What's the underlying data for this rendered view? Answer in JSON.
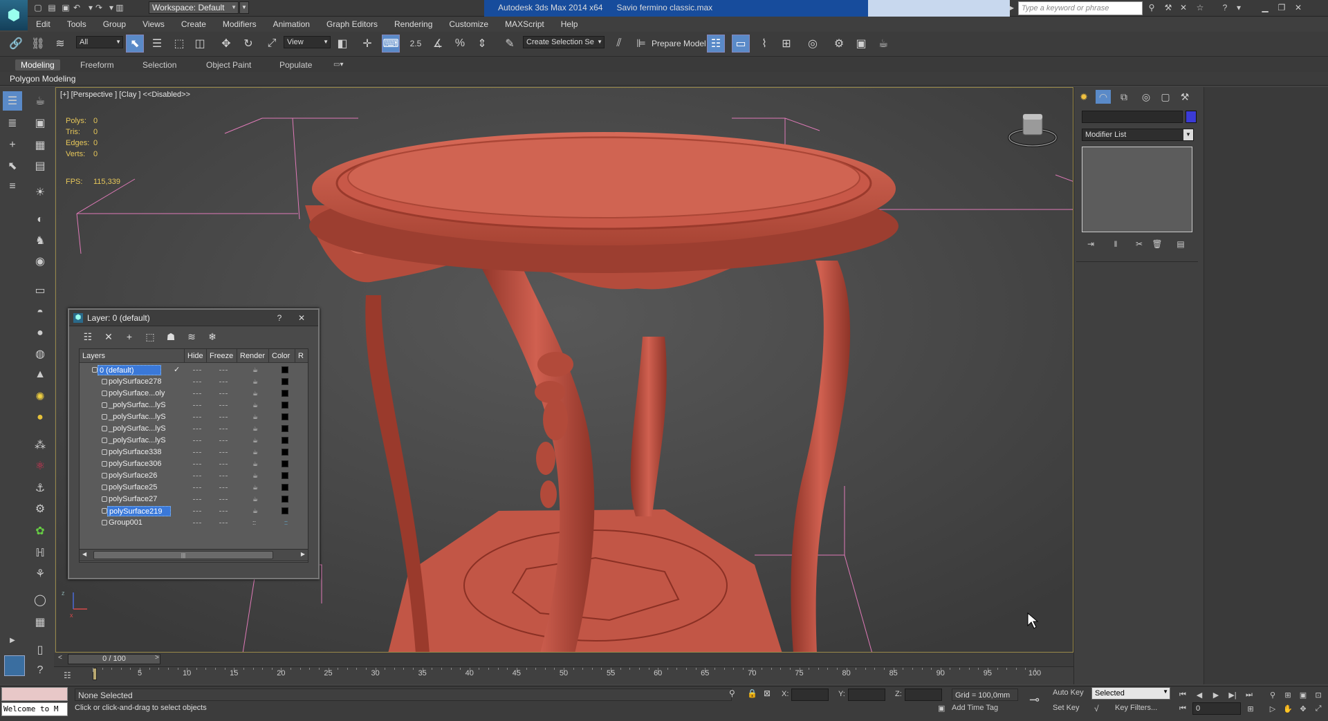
{
  "titlebar": {
    "workspace_label": "Workspace: Default",
    "app_title": "Autodesk 3ds Max  2014 x64",
    "file_name": "Savio fermino classic.max",
    "search_placeholder": "Type a keyword or phrase"
  },
  "menu": [
    "Edit",
    "Tools",
    "Group",
    "Views",
    "Create",
    "Modifiers",
    "Animation",
    "Graph Editors",
    "Rendering",
    "Customize",
    "MAXScript",
    "Help"
  ],
  "toolbar": {
    "selection_filter": "All",
    "ref_coord": "View",
    "snap_value": "2.5",
    "named_selection_placeholder": "Create Selection Se",
    "prepare_model": "Prepare Model"
  },
  "ribbon": {
    "tabs": [
      "Modeling",
      "Freeform",
      "Selection",
      "Object Paint",
      "Populate"
    ],
    "active_tab": "Modeling",
    "panel_label": "Polygon Modeling"
  },
  "viewport": {
    "label": "[+] [Perspective ] [Clay ]  <<Disabled>>",
    "stats": [
      {
        "label": "Polys:",
        "value": "0"
      },
      {
        "label": "Tris:",
        "value": "0"
      },
      {
        "label": "Edges:",
        "value": "0"
      },
      {
        "label": "Verts:",
        "value": "0"
      }
    ],
    "fps_label": "FPS:",
    "fps_value": "115,339",
    "axis_x": "x",
    "axis_z": "z"
  },
  "layer_dialog": {
    "title": "Layer: 0 (default)",
    "help": "?",
    "close": "✕",
    "columns": [
      "Layers",
      "Hide",
      "Freeze",
      "Render",
      "Color",
      "R"
    ],
    "rows": [
      {
        "name": "0 (default)",
        "type": "layer",
        "selected": true,
        "current": true
      },
      {
        "name": "polySurface278",
        "type": "object"
      },
      {
        "name": "polySurface...oly",
        "type": "object"
      },
      {
        "name": "_polySurfac...lyS",
        "type": "object"
      },
      {
        "name": "_polySurfac...lyS",
        "type": "object"
      },
      {
        "name": "_polySurfac...lyS",
        "type": "object"
      },
      {
        "name": "_polySurfac...lyS",
        "type": "object"
      },
      {
        "name": "polySurface338",
        "type": "object"
      },
      {
        "name": "polySurface306",
        "type": "object"
      },
      {
        "name": "polySurface26",
        "type": "object"
      },
      {
        "name": "polySurface25",
        "type": "object"
      },
      {
        "name": "polySurface27",
        "type": "object"
      },
      {
        "name": "polySurface219",
        "type": "object",
        "selected": true
      },
      {
        "name": "Group001",
        "type": "group"
      }
    ]
  },
  "command_panel": {
    "modifier_list": "Modifier List",
    "swatch_color": "#3b3bd6"
  },
  "timeline": {
    "frame_counter": "0 / 100",
    "ticks": [
      "0",
      "5",
      "10",
      "15",
      "20",
      "25",
      "30",
      "35",
      "40",
      "45",
      "50",
      "55",
      "60",
      "65",
      "70",
      "75",
      "80",
      "85",
      "90",
      "95",
      "100"
    ]
  },
  "status": {
    "maxscript": "Welcome to M",
    "selection": "None Selected",
    "prompt": "Click or click-and-drag to select objects",
    "x_label": "X:",
    "y_label": "Y:",
    "z_label": "Z:",
    "grid": "Grid = 100,0mm",
    "add_time_tag": "Add Time Tag",
    "auto_key": "Auto Key",
    "set_key": "Set Key",
    "key_mode": "Selected",
    "key_filters": "Key Filters...",
    "current_frame": "0"
  },
  "colors": {
    "table_color": "#c95a48",
    "accent_blue": "#3a78d8",
    "title_blue": "#174c9c"
  }
}
